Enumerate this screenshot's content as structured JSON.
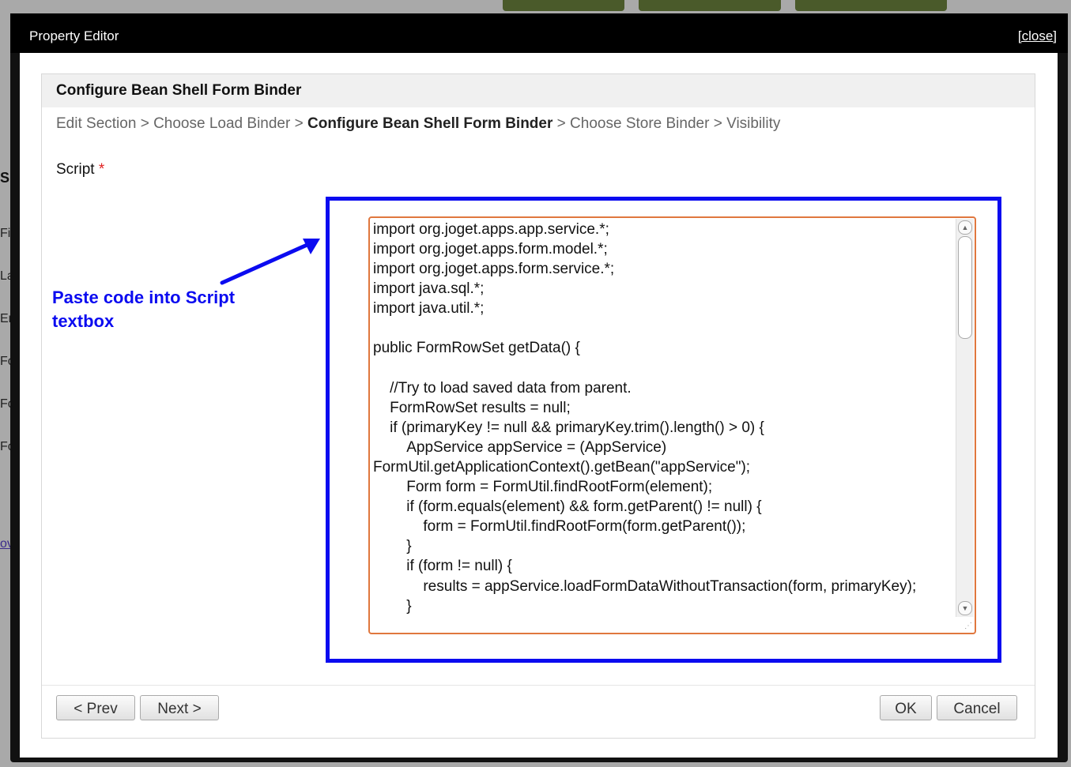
{
  "window": {
    "title": "Property Editor",
    "close_label": "[close]"
  },
  "panel": {
    "title": "Configure Bean Shell Form Binder",
    "breadcrumb": [
      {
        "label": "Edit Section",
        "current": false
      },
      {
        "label": "Choose Load Binder",
        "current": false
      },
      {
        "label": "Configure Bean Shell Form Binder",
        "current": true
      },
      {
        "label": "Choose Store Binder",
        "current": false
      },
      {
        "label": "Visibility",
        "current": false
      }
    ],
    "breadcrumb_separator": ">"
  },
  "script_field": {
    "label": "Script",
    "required_marker": "*",
    "lines": [
      "import org.joget.apps.app.service.*;",
      "import org.joget.apps.form.model.*;",
      "import org.joget.apps.form.service.*;",
      "import java.sql.*;",
      "import java.util.*;",
      "",
      "public FormRowSet getData() {",
      "",
      "    //Try to load saved data from parent.",
      "    FormRowSet results = null;",
      "    if (primaryKey != null && primaryKey.trim().length() > 0) {",
      "        AppService appService = (AppService) FormUtil.getApplicationContext().getBean(\"appService\");",
      "        Form form = FormUtil.findRootForm(element);",
      "        if (form.equals(element) && form.getParent() != null) {",
      "            form = FormUtil.findRootForm(form.getParent());",
      "        }",
      "        if (form != null) {",
      "            results = appService.loadFormDataWithoutTransaction(form, primaryKey);",
      "        }"
    ]
  },
  "annotation": {
    "text": "Paste code into Script textbox",
    "color": "#0b0bf0"
  },
  "buttons": {
    "prev": "< Prev",
    "next": "Next >",
    "ok": "OK",
    "cancel": "Cancel"
  },
  "background_fragments": [
    "S",
    "Fir",
    "La",
    "En",
    "Fo",
    "Fo",
    "Fo",
    "ov"
  ]
}
